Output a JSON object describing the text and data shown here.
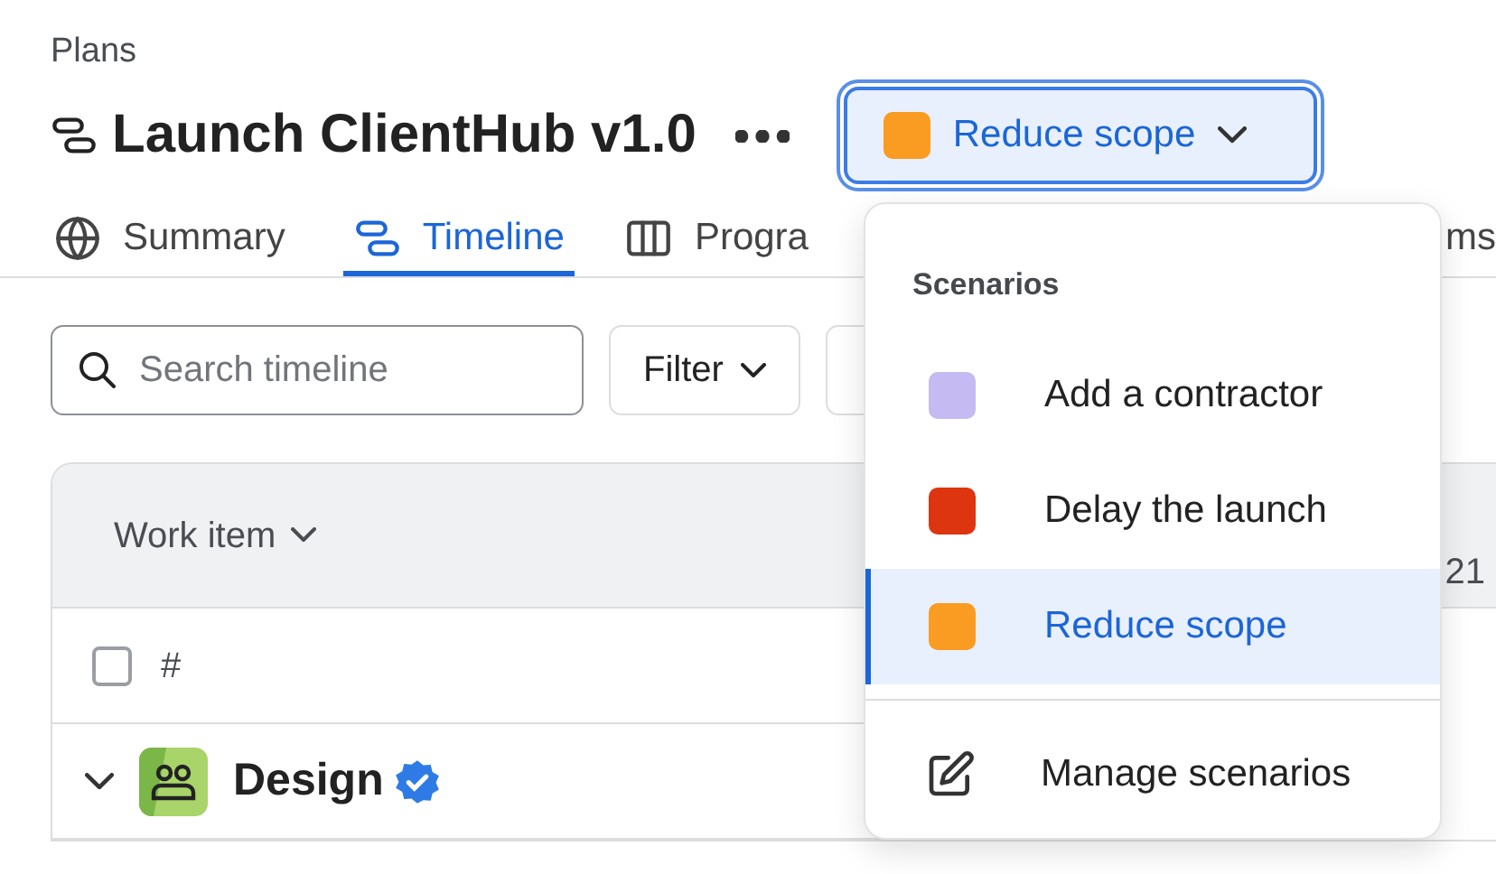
{
  "breadcrumb": "Plans",
  "title": "Launch ClientHub v1.0",
  "scenario_button": {
    "label": "Reduce scope",
    "color": "#fa9b22",
    "expanded": true
  },
  "tabs": [
    {
      "label": "Summary",
      "kind": "globe",
      "selected": false
    },
    {
      "label": "Timeline",
      "kind": "timeline",
      "selected": true
    },
    {
      "label": "Progra",
      "kind": "columns",
      "selected": false
    },
    {
      "label": "ms",
      "kind": "none",
      "selected": false
    }
  ],
  "search": {
    "placeholder": "Search timeline"
  },
  "filter_button": {
    "label": "Filter"
  },
  "table": {
    "column_header": "Work item",
    "column_2_header": "21",
    "select_all": {
      "checked": false
    },
    "number_header": "#",
    "rows": [
      {
        "name": "Design",
        "expanded": true,
        "verified": true
      }
    ]
  },
  "scenario_menu": {
    "heading": "Scenarios",
    "items": [
      {
        "label": "Add a contractor",
        "color": "#c5baf1",
        "selected": false
      },
      {
        "label": "Delay the launch",
        "color": "#dc3510",
        "selected": false
      },
      {
        "label": "Reduce scope",
        "color": "#fa9b22",
        "selected": true
      }
    ],
    "manage": {
      "label": "Manage scenarios"
    }
  }
}
